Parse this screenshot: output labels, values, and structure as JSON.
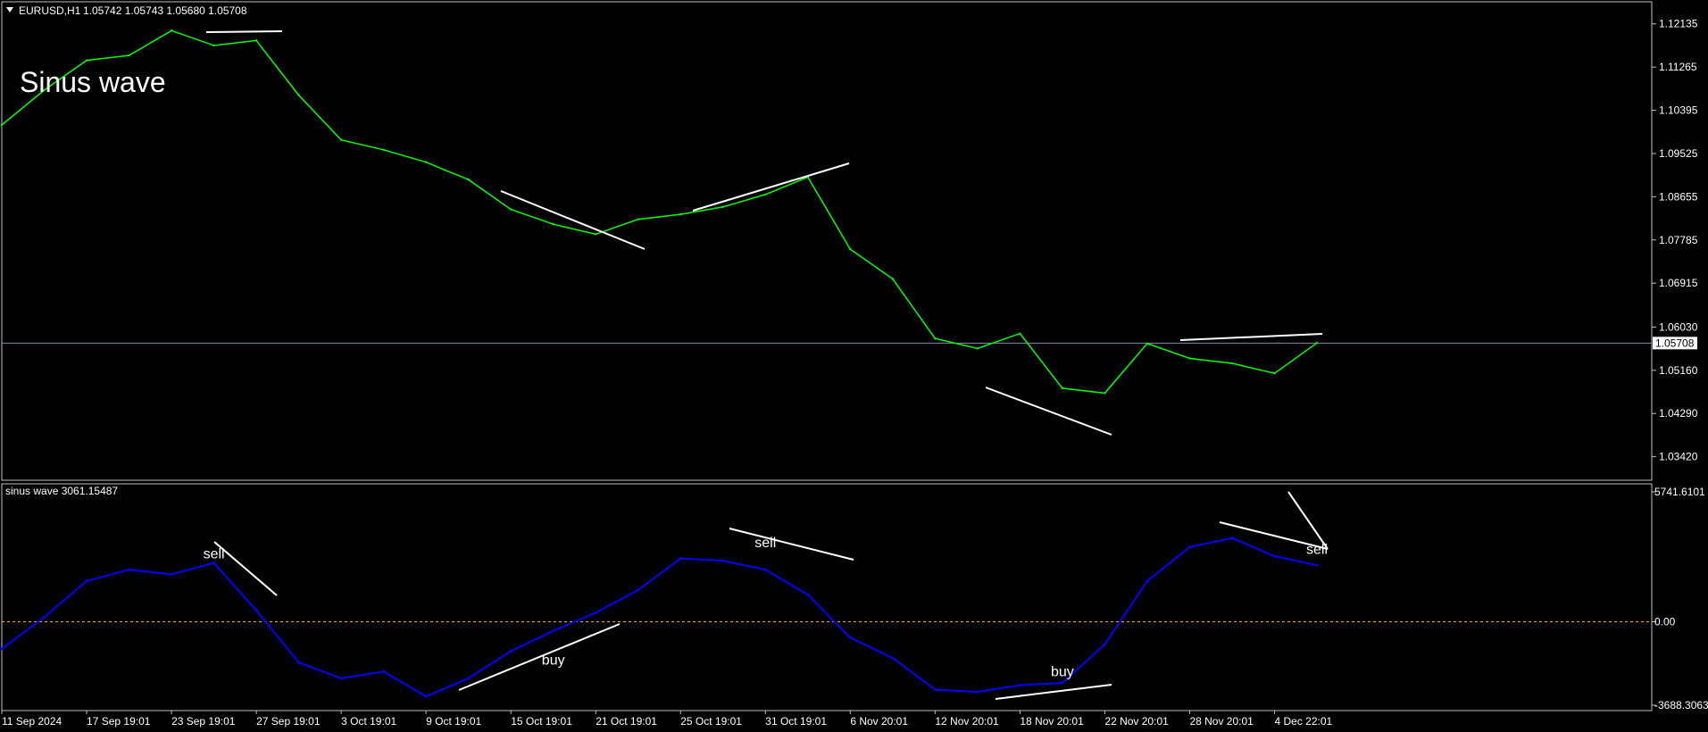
{
  "header": {
    "symbol": "EURUSD,H1",
    "ohlc": "1.05742 1.05743 1.05680 1.05708",
    "overlay_label": "Sinus wave"
  },
  "indicator": {
    "title": "sinus wave 3061.15487"
  },
  "colors": {
    "price_line": "#00ff00",
    "indicator_line": "#0000ff",
    "trendline": "#ffffff",
    "zero_line": "#ffb000",
    "bid_line": "#7f8fb0",
    "frame": "#c0c0c0"
  },
  "chart_data": [
    {
      "type": "line",
      "title": "EURUSD,H1",
      "y_ticks": [
        "1.12135",
        "1.11265",
        "1.10395",
        "1.09525",
        "1.08655",
        "1.07785",
        "1.06915",
        "1.06030",
        "1.05160",
        "1.04290",
        "1.03420"
      ],
      "ylim": [
        1.03,
        1.124
      ],
      "current_price": 1.05708,
      "current_price_label": "1.05708",
      "x": [
        "11 Sep 2024",
        "14 Sep",
        "17 Sep 19:01",
        "20 Sep",
        "23 Sep 19:01",
        "25 Sep",
        "27 Sep 19:01",
        "30 Sep",
        "3 Oct 19:01",
        "6 Oct",
        "9 Oct 19:01",
        "12 Oct",
        "15 Oct 19:01",
        "18 Oct",
        "21 Oct 19:01",
        "23 Oct",
        "25 Oct 19:01",
        "28 Oct",
        "31 Oct 19:01",
        "3 Nov",
        "6 Nov 20:01",
        "9 Nov",
        "12 Nov 20:01",
        "15 Nov",
        "18 Nov 20:01",
        "20 Nov",
        "22 Nov 20:01",
        "25 Nov",
        "28 Nov 20:01",
        "1 Dec",
        "4 Dec 22:01",
        "6 Dec"
      ],
      "x_ticks": [
        "11 Sep 2024",
        "17 Sep 19:01",
        "23 Sep 19:01",
        "27 Sep 19:01",
        "3 Oct 19:01",
        "9 Oct 19:01",
        "15 Oct 19:01",
        "21 Oct 19:01",
        "25 Oct 19:01",
        "31 Oct 19:01",
        "6 Nov 20:01",
        "12 Nov 20:01",
        "18 Nov 20:01",
        "22 Nov 20:01",
        "28 Nov 20:01",
        "4 Dec 22:01"
      ],
      "values": [
        1.101,
        1.108,
        1.114,
        1.115,
        1.12,
        1.117,
        1.118,
        1.107,
        1.098,
        1.096,
        1.0935,
        1.09,
        1.084,
        1.081,
        1.079,
        1.082,
        1.083,
        1.0845,
        1.087,
        1.0905,
        1.076,
        1.07,
        1.058,
        1.056,
        1.059,
        1.048,
        1.047,
        1.057,
        1.054,
        1.053,
        1.051,
        1.0571
      ],
      "grid": false
    },
    {
      "type": "line",
      "title": "sinus wave 3061.15487",
      "y_ticks": [
        "5741.6101",
        "0.00",
        "-3688.3063"
      ],
      "ylim": [
        -3688.3063,
        5741.6101
      ],
      "zero_line": 0,
      "x": [
        "11 Sep 2024",
        "14 Sep",
        "17 Sep 19:01",
        "20 Sep",
        "23 Sep 19:01",
        "25 Sep",
        "27 Sep 19:01",
        "30 Sep",
        "3 Oct 19:01",
        "6 Oct",
        "9 Oct 19:01",
        "12 Oct",
        "15 Oct 19:01",
        "18 Oct",
        "21 Oct 19:01",
        "23 Oct",
        "25 Oct 19:01",
        "28 Oct",
        "31 Oct 19:01",
        "3 Nov",
        "6 Nov 20:01",
        "9 Nov",
        "12 Nov 20:01",
        "15 Nov",
        "18 Nov 20:01",
        "20 Nov",
        "22 Nov 20:01",
        "25 Nov",
        "28 Nov 20:01",
        "1 Dec",
        "4 Dec 22:01",
        "6 Dec"
      ],
      "values": [
        -1200,
        200,
        1800,
        2300,
        2100,
        2600,
        500,
        -1800,
        -2500,
        -2200,
        -3300,
        -2500,
        -1300,
        -400,
        400,
        1400,
        2800,
        2700,
        2300,
        1200,
        -700,
        -1600,
        -3000,
        -3100,
        -2800,
        -2700,
        -1000,
        1800,
        3300,
        3700,
        2900,
        2500
      ],
      "annotations": [
        {
          "text": "sell",
          "x": "25 Sep",
          "y": 2800
        },
        {
          "text": "buy",
          "x": "18 Oct",
          "y": -1900
        },
        {
          "text": "sell",
          "x": "31 Oct 19:01",
          "y": 3300
        },
        {
          "text": "buy",
          "x": "20 Nov",
          "y": -2400
        },
        {
          "text": "sell",
          "x": "6 Dec",
          "y": 3000
        }
      ],
      "grid": false
    }
  ]
}
